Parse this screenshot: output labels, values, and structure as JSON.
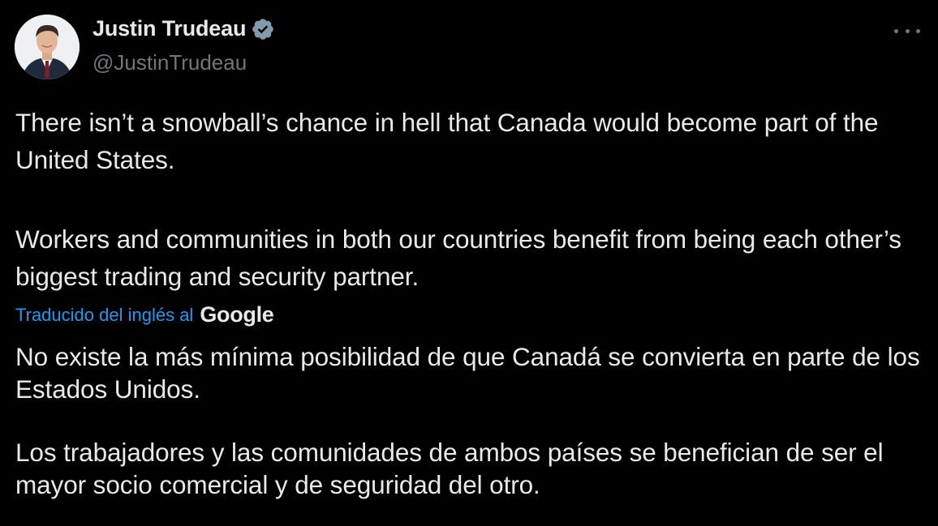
{
  "author": {
    "display_name": "Justin Trudeau",
    "handle": "@JustinTrudeau",
    "verified": true
  },
  "tweet": {
    "paragraph_1": "There isn’t a snowball’s chance in hell that Canada would become part of the United States.",
    "paragraph_2": "Workers and communities in both our countries benefit from being each other’s biggest trading and security partner."
  },
  "translation": {
    "label": "Traducido del inglés al",
    "provider": "Google",
    "paragraph_1": "No existe la más mínima posibilidad de que Canadá se convierta en parte de los Estados Unidos.",
    "paragraph_2": "Los trabajadores y las comunidades de ambos países se benefician de ser el mayor socio comercial y de seguridad del otro."
  },
  "icons": {
    "verified": "verified-badge-icon",
    "more": "more-options-icon"
  },
  "colors": {
    "background": "#000000",
    "text": "#e7e9ea",
    "secondary": "#71767b",
    "accent": "#1d9bf0"
  }
}
